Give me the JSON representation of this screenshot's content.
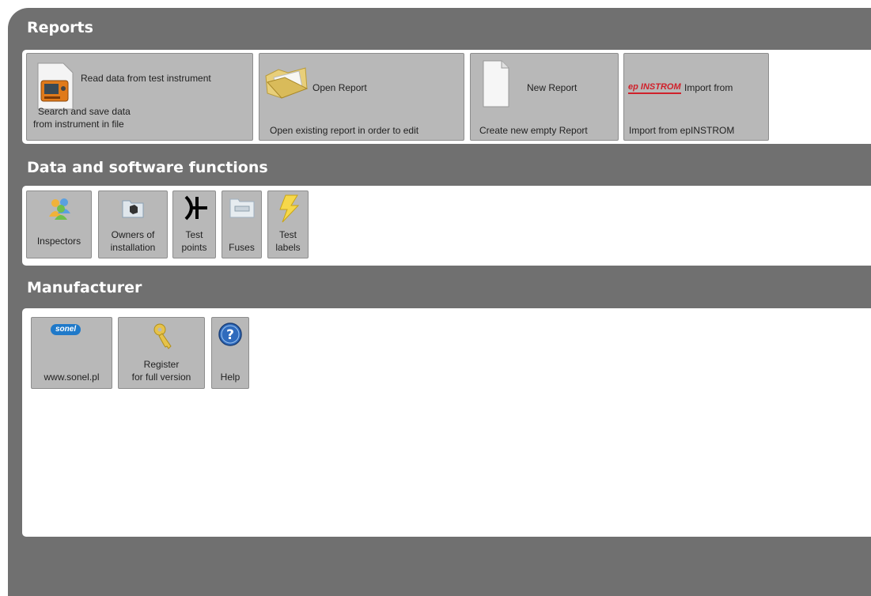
{
  "sections": {
    "reports": {
      "title": "Reports",
      "tiles": {
        "read": {
          "title": "Read data from test instrument",
          "desc_line1": "Search and save data",
          "desc_line2": "from instrument in file"
        },
        "open": {
          "title": "Open Report",
          "desc": "Open existing report in order to edit"
        },
        "new": {
          "title": "New Report",
          "desc": "Create new empty Report"
        },
        "import": {
          "logo": "ep INSTROM",
          "title": "Import from",
          "desc": "Import from epINSTROM"
        }
      }
    },
    "data": {
      "title": "Data and software functions",
      "tiles": {
        "inspectors": {
          "label": "Inspectors"
        },
        "owners": {
          "label_line1": "Owners of",
          "label_line2": "installation"
        },
        "test_points": {
          "label_line1": "Test",
          "label_line2": "points"
        },
        "fuses": {
          "label": "Fuses"
        },
        "test_labels": {
          "label_line1": "Test",
          "label_line2": "labels"
        }
      }
    },
    "manufacturer": {
      "title": "Manufacturer",
      "tiles": {
        "sonel": {
          "logo": "sonel",
          "label": "www.sonel.pl"
        },
        "register": {
          "label_line1": "Register",
          "label_line2": "for full version"
        },
        "help": {
          "label": "Help"
        }
      }
    }
  },
  "icons": {
    "read": "test-instrument-icon",
    "open": "open-folder-icon",
    "new": "blank-document-icon",
    "inspectors": "people-icon",
    "owners": "folder-box-icon",
    "test_points": "test-point-symbol-icon",
    "fuses": "fuse-folder-icon",
    "test_labels": "lightning-label-icon",
    "register": "key-icon",
    "help": "help-icon"
  },
  "colors": {
    "frame": "#707070",
    "tile": "#b8b8b8",
    "panel": "#ffffff",
    "title": "#ffffff",
    "instrom_red": "#d0202a"
  }
}
